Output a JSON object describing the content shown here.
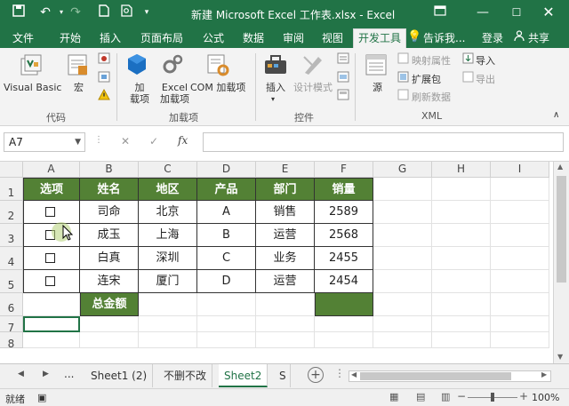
{
  "window": {
    "title": "新建 Microsoft Excel 工作表.xlsx - Excel",
    "restore_icon": "ribbon-display-icon",
    "colors": {
      "brand": "#217346",
      "header_fill": "#538135"
    }
  },
  "ribbon_tabs": [
    "文件",
    "开始",
    "插入",
    "页面布局",
    "公式",
    "数据",
    "审阅",
    "视图",
    "开发工具"
  ],
  "tell_me": "告诉我...",
  "signin": "登录",
  "share": "共享",
  "ribbon": {
    "visual_basic": "Visual Basic",
    "macro": "宏",
    "code_group": "代码",
    "add_in_line1": "加",
    "add_in_line2": "载项",
    "excel_add_in_line1": "Excel",
    "excel_add_in_line2": "加载项",
    "com_add_in": "COM 加载项",
    "addins_group": "加载项",
    "insert": "插入",
    "design_mode": "设计模式",
    "controls_group": "控件",
    "source": "源",
    "map_properties": "映射属性",
    "expansion_packs": "扩展包",
    "refresh_data": "刷新数据",
    "import": "导入",
    "export": "导出",
    "xml_group": "XML"
  },
  "name_box": "A7",
  "fx_label": "fx",
  "formula_value": "",
  "columns": [
    "A",
    "B",
    "C",
    "D",
    "E",
    "F",
    "G",
    "H",
    "I"
  ],
  "rows": [
    "1",
    "2",
    "3",
    "4",
    "5",
    "6",
    "7",
    "8"
  ],
  "table": {
    "headers": [
      "选项",
      "姓名",
      "地区",
      "产品",
      "部门",
      "销量"
    ],
    "rows": [
      [
        "",
        "司命",
        "北京",
        "A",
        "销售",
        "2589"
      ],
      [
        "",
        "成玉",
        "上海",
        "B",
        "运营",
        "2568"
      ],
      [
        "",
        "白真",
        "深圳",
        "C",
        "业务",
        "2455"
      ],
      [
        "",
        "连宋",
        "厦门",
        "D",
        "运营",
        "2454"
      ]
    ],
    "total_label": "总金额",
    "total_value": ""
  },
  "sheet_tabs": [
    "Sheet1 (2)",
    "不删不改",
    "Sheet2",
    "S"
  ],
  "active_sheet": "Sheet2",
  "sheet_ellipsis": "...",
  "status": {
    "ready": "就绪",
    "zoom": "100%"
  }
}
